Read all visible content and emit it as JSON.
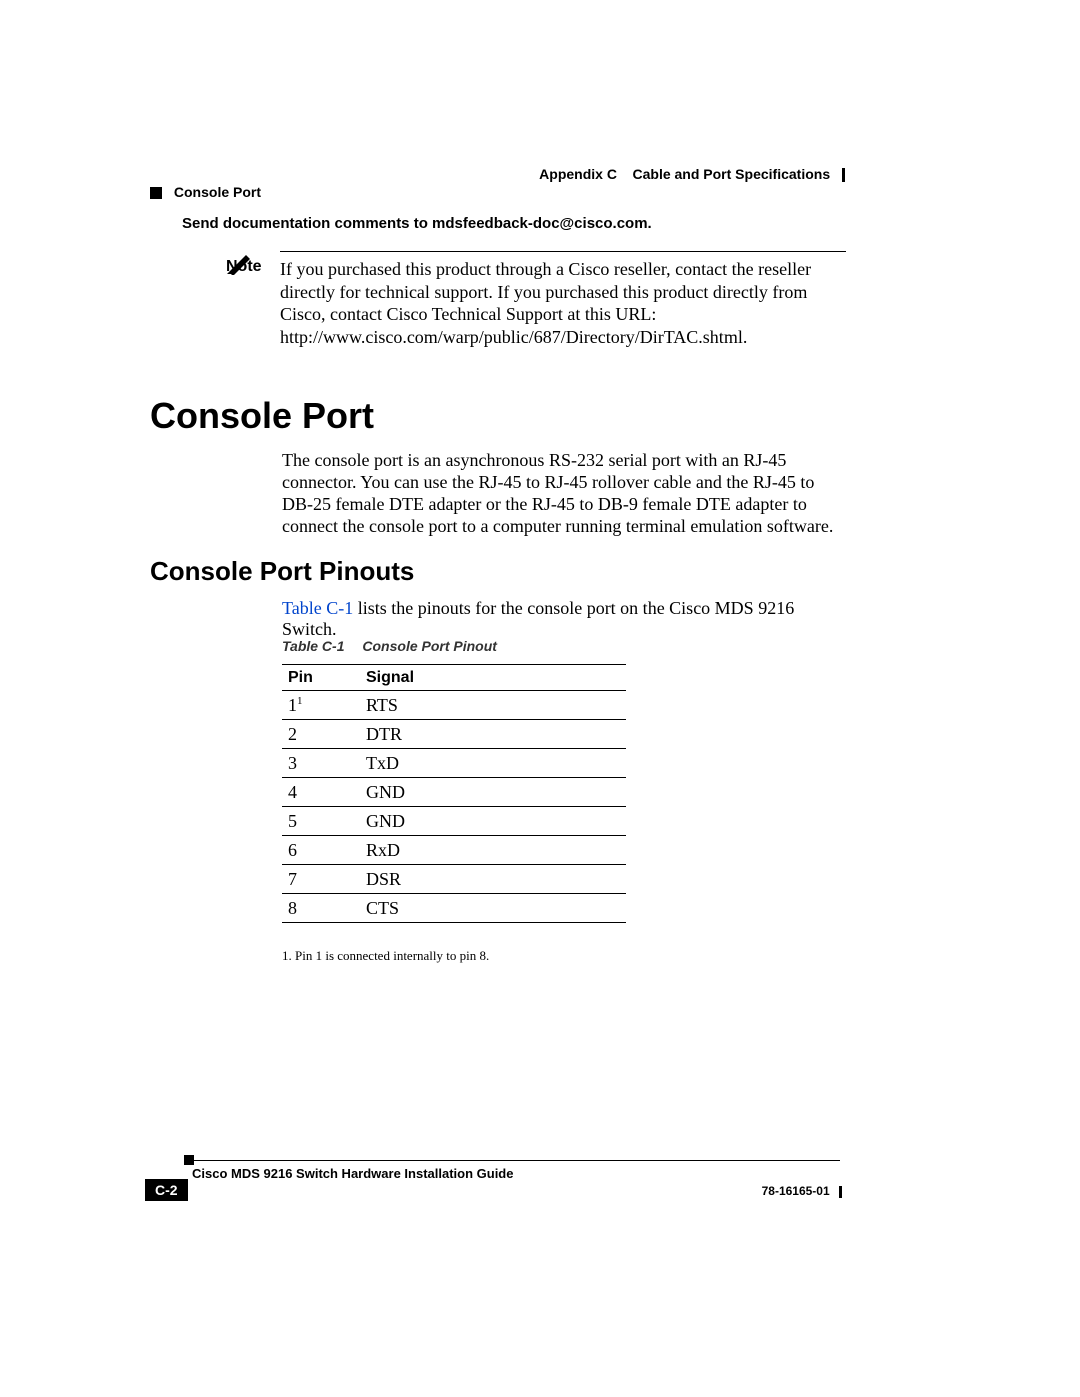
{
  "header": {
    "appendix": "Appendix C",
    "chapter_title": "Cable and Port Specifications",
    "section": "Console Port"
  },
  "feedback": "Send documentation comments to mdsfeedback-doc@cisco.com.",
  "note": {
    "label": "Note",
    "text": "If you purchased this product through a Cisco reseller, contact the reseller directly for technical support. If you purchased this product directly from Cisco, contact Cisco Technical Support at this URL: http://www.cisco.com/warp/public/687/Directory/DirTAC.shtml."
  },
  "h1": "Console Port",
  "p1": "The console port is an asynchronous RS-232 serial port with an RJ-45 connector. You can use the RJ-45 to RJ-45 rollover cable and the RJ-45 to DB-25 female DTE adapter or the RJ-45 to DB-9 female DTE adapter to connect the console port to a computer running terminal emulation software.",
  "h2": "Console Port Pinouts",
  "p2_link": "Table C-1",
  "p2_rest": " lists the pinouts for the console port on the Cisco MDS 9216 Switch.",
  "table": {
    "number": "Table C-1",
    "title": "Console Port Pinout",
    "columns": [
      "Pin",
      "Signal"
    ],
    "rows": [
      {
        "pin": "1",
        "sup": "1",
        "signal": "RTS"
      },
      {
        "pin": "2",
        "sup": "",
        "signal": "DTR"
      },
      {
        "pin": "3",
        "sup": "",
        "signal": "TxD"
      },
      {
        "pin": "4",
        "sup": "",
        "signal": "GND"
      },
      {
        "pin": "5",
        "sup": "",
        "signal": "GND"
      },
      {
        "pin": "6",
        "sup": "",
        "signal": "RxD"
      },
      {
        "pin": "7",
        "sup": "",
        "signal": "DSR"
      },
      {
        "pin": "8",
        "sup": "",
        "signal": "CTS"
      }
    ],
    "footnote": "1.  Pin 1 is connected internally to pin 8."
  },
  "footer": {
    "guide": "Cisco MDS 9216 Switch Hardware Installation Guide",
    "page": "C-2",
    "docnum": "78-16165-01"
  }
}
